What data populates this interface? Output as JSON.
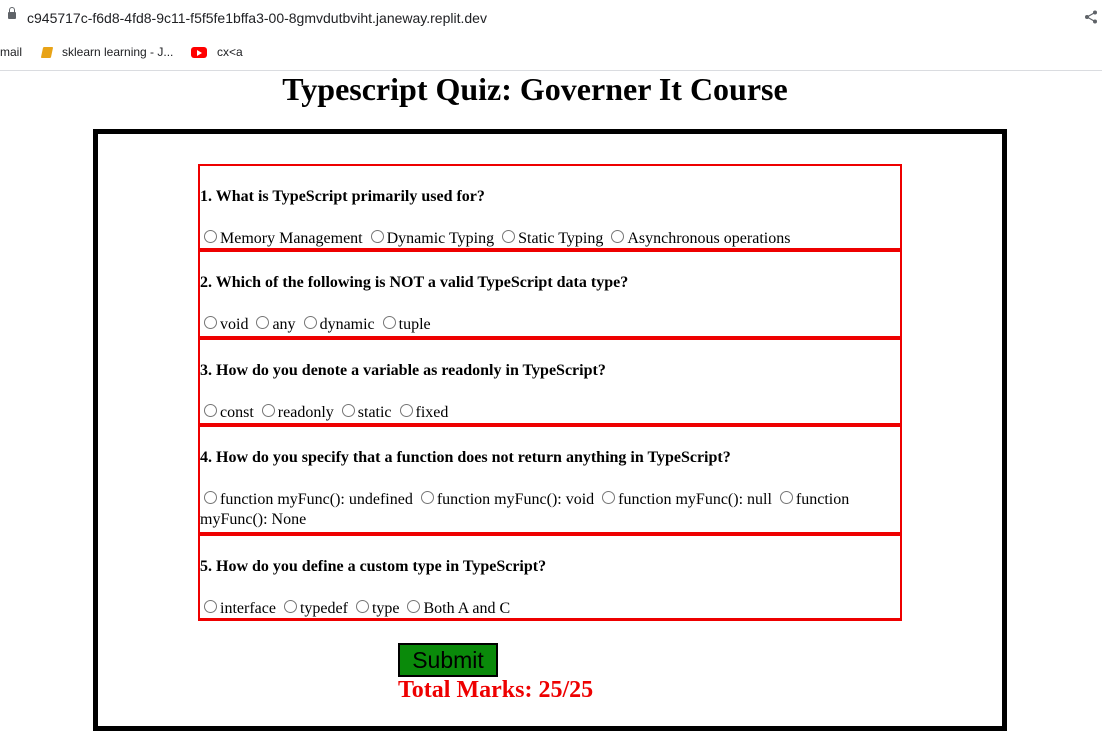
{
  "browser": {
    "url": "c945717c-f6d8-4fd8-9c11-f5f5fe1bffa3-00-8gmvdutbviht.janeway.replit.dev",
    "bookmarks": [
      {
        "label": "mail",
        "icon": "none"
      },
      {
        "label": "sklearn learning - J...",
        "icon": "book-icon"
      },
      {
        "label": "cx<a",
        "icon": "youtube-icon"
      }
    ]
  },
  "page": {
    "title": "Typescript Quiz: Governer It Course",
    "submit_label": "Submit",
    "total_label": "Total Marks: 25/25"
  },
  "questions": [
    {
      "text": "1. What is TypeScript primarily used for?",
      "options": [
        "Memory Management",
        "Dynamic Typing",
        "Static Typing",
        "Asynchronous operations"
      ]
    },
    {
      "text": "2. Which of the following is NOT a valid TypeScript data type?",
      "options": [
        "void",
        "any",
        "dynamic",
        "tuple"
      ]
    },
    {
      "text": "3. How do you denote a variable as readonly in TypeScript?",
      "options": [
        "const",
        "readonly",
        "static",
        "fixed"
      ]
    },
    {
      "text": "4. How do you specify that a function does not return anything in TypeScript?",
      "options": [
        "function myFunc(): undefined",
        "function myFunc(): void",
        "function myFunc(): null",
        "function myFunc(): None"
      ]
    },
    {
      "text": "5. How do you define a custom type in TypeScript?",
      "options": [
        "interface",
        "typedef",
        "type",
        "Both A and C"
      ]
    }
  ],
  "colors": {
    "accent_red": "#ee0000",
    "submit_green": "#0a8a0a"
  }
}
